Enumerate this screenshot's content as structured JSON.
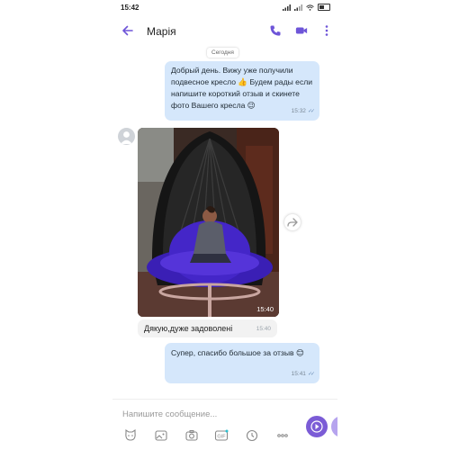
{
  "status_bar": {
    "time": "15:42"
  },
  "header": {
    "contact_name": "Марія"
  },
  "date_divider": "Сегодня",
  "messages": [
    {
      "direction": "out",
      "text": "Добрый день. Вижу уже получили подвесное кресло 👍 Будем рады если напишите короткий отзыв и скинете фото Вашего кресла 😉",
      "time": "15:32",
      "status": "read"
    },
    {
      "direction": "in",
      "type": "photo",
      "time": "15:40"
    },
    {
      "direction": "in",
      "text": "Дякую,дуже задоволені",
      "time": "15:40"
    },
    {
      "direction": "out",
      "text": "Супер, спасибо большое за отзыв 😊",
      "time": "15:41",
      "status": "read"
    }
  ],
  "composer": {
    "placeholder": "Напишите сообщение..."
  },
  "icons": {
    "back": "arrow-left-icon",
    "call": "phone-icon",
    "video": "video-camera-icon",
    "more": "more-vertical-icon",
    "share": "share-forward-icon",
    "sticker": "sticker-cat-icon",
    "gallery": "gallery-icon",
    "camera": "camera-icon",
    "gif": "gif-icon",
    "timer": "clock-icon",
    "more_actions": "ellipsis-icon",
    "send": "send-icon"
  },
  "colors": {
    "accent": "#7360f2",
    "outgoing_bubble": "#d5e7fb",
    "incoming_bubble": "#f2f2f2"
  }
}
